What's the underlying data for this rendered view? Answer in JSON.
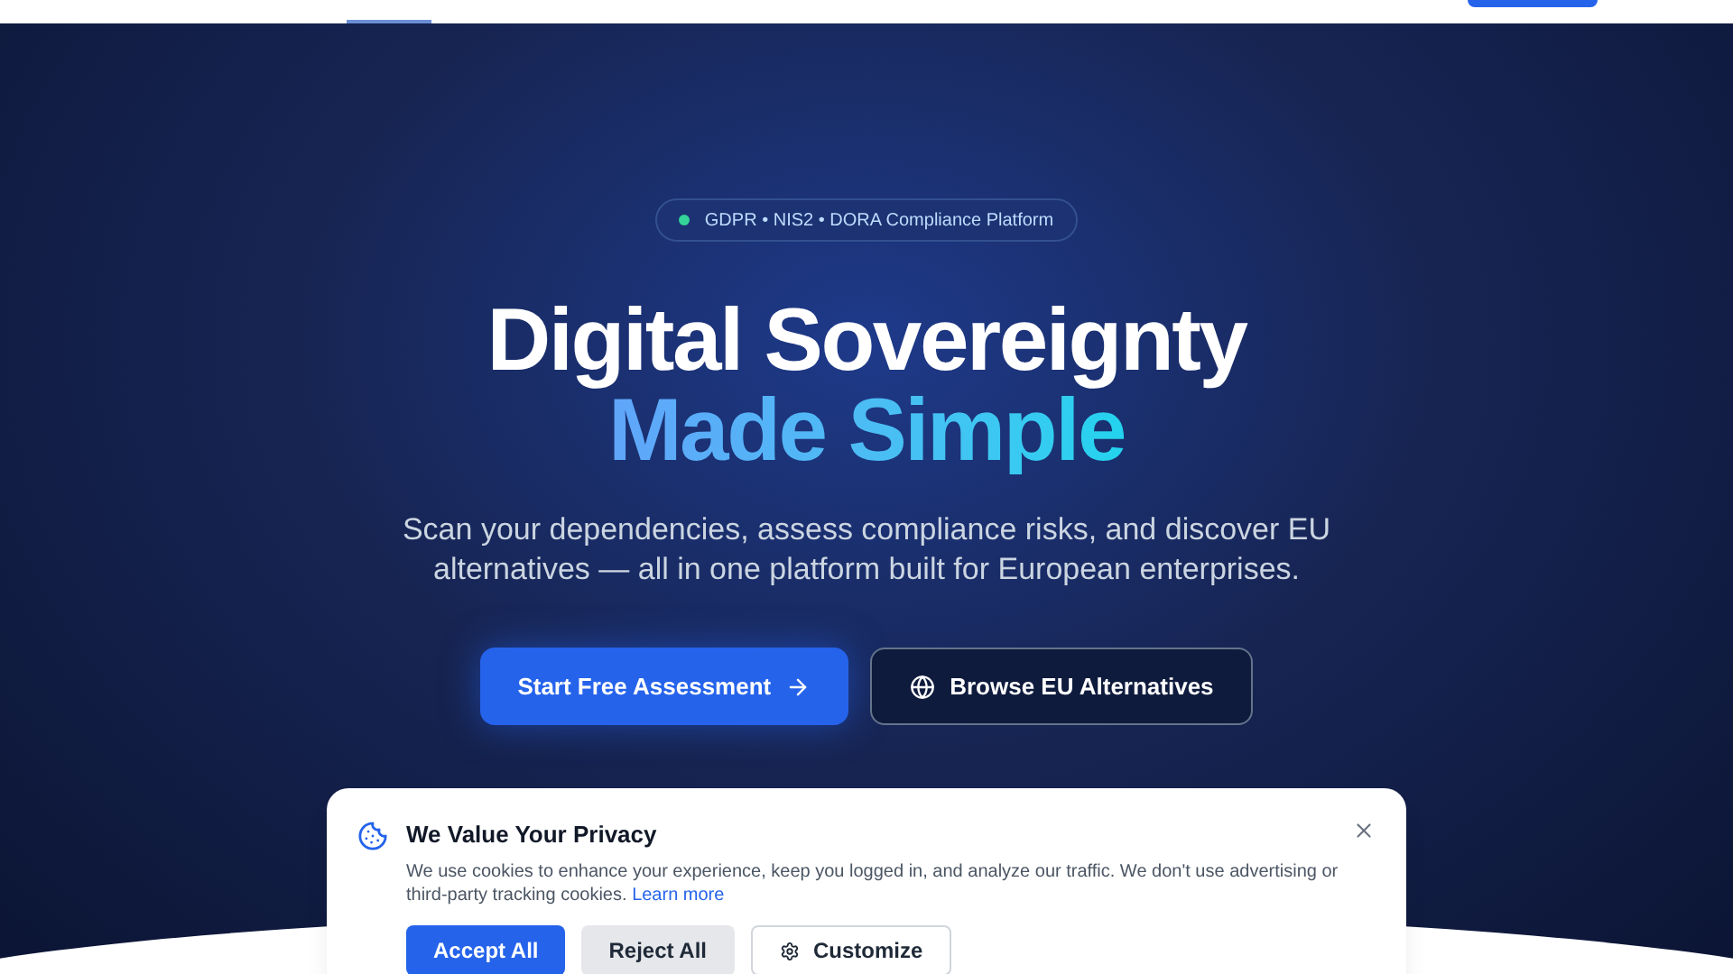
{
  "badge": {
    "text": "GDPR • NIS2 • DORA Compliance Platform",
    "color": "#34d399"
  },
  "hero": {
    "title_line_1": "Digital Sovereignty",
    "title_line_2": "Made Simple",
    "subtitle": "Scan your dependencies, assess compliance risks, and discover EU alternatives — all in one platform built for European enterprises."
  },
  "actions": [
    {
      "label": "Start Free Assessment",
      "kind": "primary"
    },
    {
      "label": "Browse EU Alternatives",
      "kind": "outline"
    }
  ],
  "cookie_banner": {
    "title": "We Value Your Privacy",
    "text": "We use cookies to enhance your experience, keep you logged in, and analyze our traffic. We don't use advertising or third-party tracking cookies.",
    "link": "Learn more",
    "buttons": [
      {
        "label": "Accept All",
        "kind": "primary"
      },
      {
        "label": "Reject All",
        "kind": "secondary"
      },
      {
        "label": "Customize",
        "kind": "outline"
      }
    ]
  }
}
